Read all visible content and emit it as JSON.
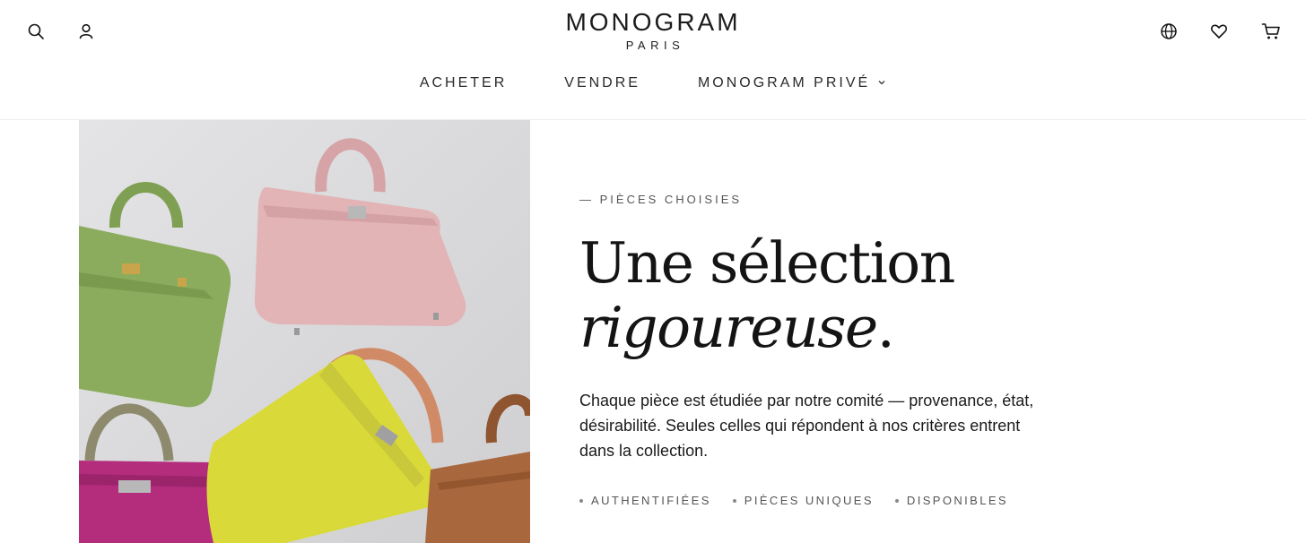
{
  "header": {
    "logo": {
      "name": "MONOGRAM",
      "sub": "PARIS"
    },
    "left_icons": [
      "search-icon",
      "account-icon"
    ],
    "right_icons": [
      "globe-icon",
      "heart-icon",
      "cart-icon"
    ]
  },
  "nav": {
    "items": [
      {
        "label": "ACHETER"
      },
      {
        "label": "VENDRE"
      },
      {
        "label": "MONOGRAM PRIVÉ",
        "has_dropdown": true
      }
    ]
  },
  "hero": {
    "eyebrow": "— PIÈCES CHOISIES",
    "headline_line1": "Une sélection",
    "headline_line2_italic": "rigoureuse",
    "headline_line2_end": ".",
    "body": "Chaque pièce est étudiée par notre comité — provenance, état, désirabilité. Seules celles qui répondent à nos critères entrent dans la collection.",
    "tags": [
      "AUTHENTIFIÉES",
      "PIÈCES UNIQUES",
      "DISPONIBLES"
    ],
    "image_subject": "handbags-photo"
  },
  "colors": {
    "text": "#1a1a1a",
    "muted": "#555555",
    "bag_green": "#8aac5c",
    "bag_pink": "#e2b4b6",
    "bag_yellow": "#d9d93a",
    "bag_magenta": "#b42d7d",
    "bag_brown": "#a9673e"
  }
}
